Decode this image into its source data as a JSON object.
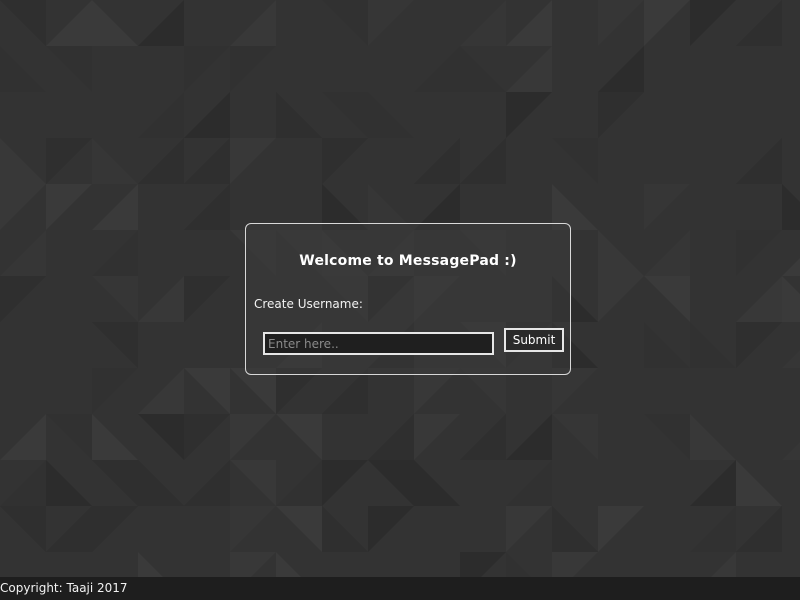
{
  "login_card": {
    "title": "Welcome to MessagePad :)",
    "field_label": "Create Username:",
    "input_placeholder": "Enter here..",
    "input_value": "",
    "submit_label": "Submit"
  },
  "footer": {
    "copyright": "Copyright: Taaji 2017"
  },
  "colors": {
    "background": "#333333",
    "card_border": "#d8d8d8",
    "input_background": "#1f1f1f",
    "footer_background": "#1e1e1e",
    "text": "#ffffff"
  }
}
